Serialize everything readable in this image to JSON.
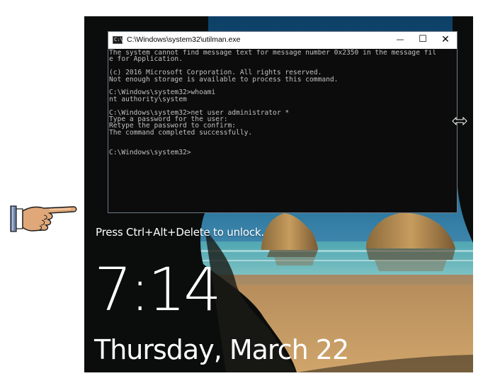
{
  "window": {
    "title": "C:\\Windows\\system32\\utilman.exe",
    "icon_label": "C:\\",
    "minimize_glyph": "—",
    "maximize_glyph": "☐",
    "close_glyph": "✕"
  },
  "console": {
    "lines": [
      "The system cannot find message text for message number 0x2350 in the message fil",
      "e for Application.",
      "",
      "(c) 2016 Microsoft Corporation. All rights reserved.",
      "Not enough storage is available to process this command.",
      "",
      "C:\\Windows\\system32>whoami",
      "nt authority\\system",
      "",
      "C:\\Windows\\system32>net user administrator *",
      "Type a password for the user:",
      "Retype the password to confirm:",
      "The command completed successfully.",
      "",
      "",
      "C:\\Windows\\system32>"
    ]
  },
  "lockscreen": {
    "unlock_prompt": "Press Ctrl+Alt+Delete to unlock.",
    "time": "7:14",
    "date": "Thursday, March 22"
  },
  "icons": {
    "pointer": "pointing-hand-icon",
    "cursor": "resize-horizontal-cursor-icon",
    "console": "console-icon"
  },
  "colors": {
    "console_bg": "#0c0c0c",
    "console_text": "#c0c0c0",
    "titlebar_bg": "#ffffff"
  }
}
